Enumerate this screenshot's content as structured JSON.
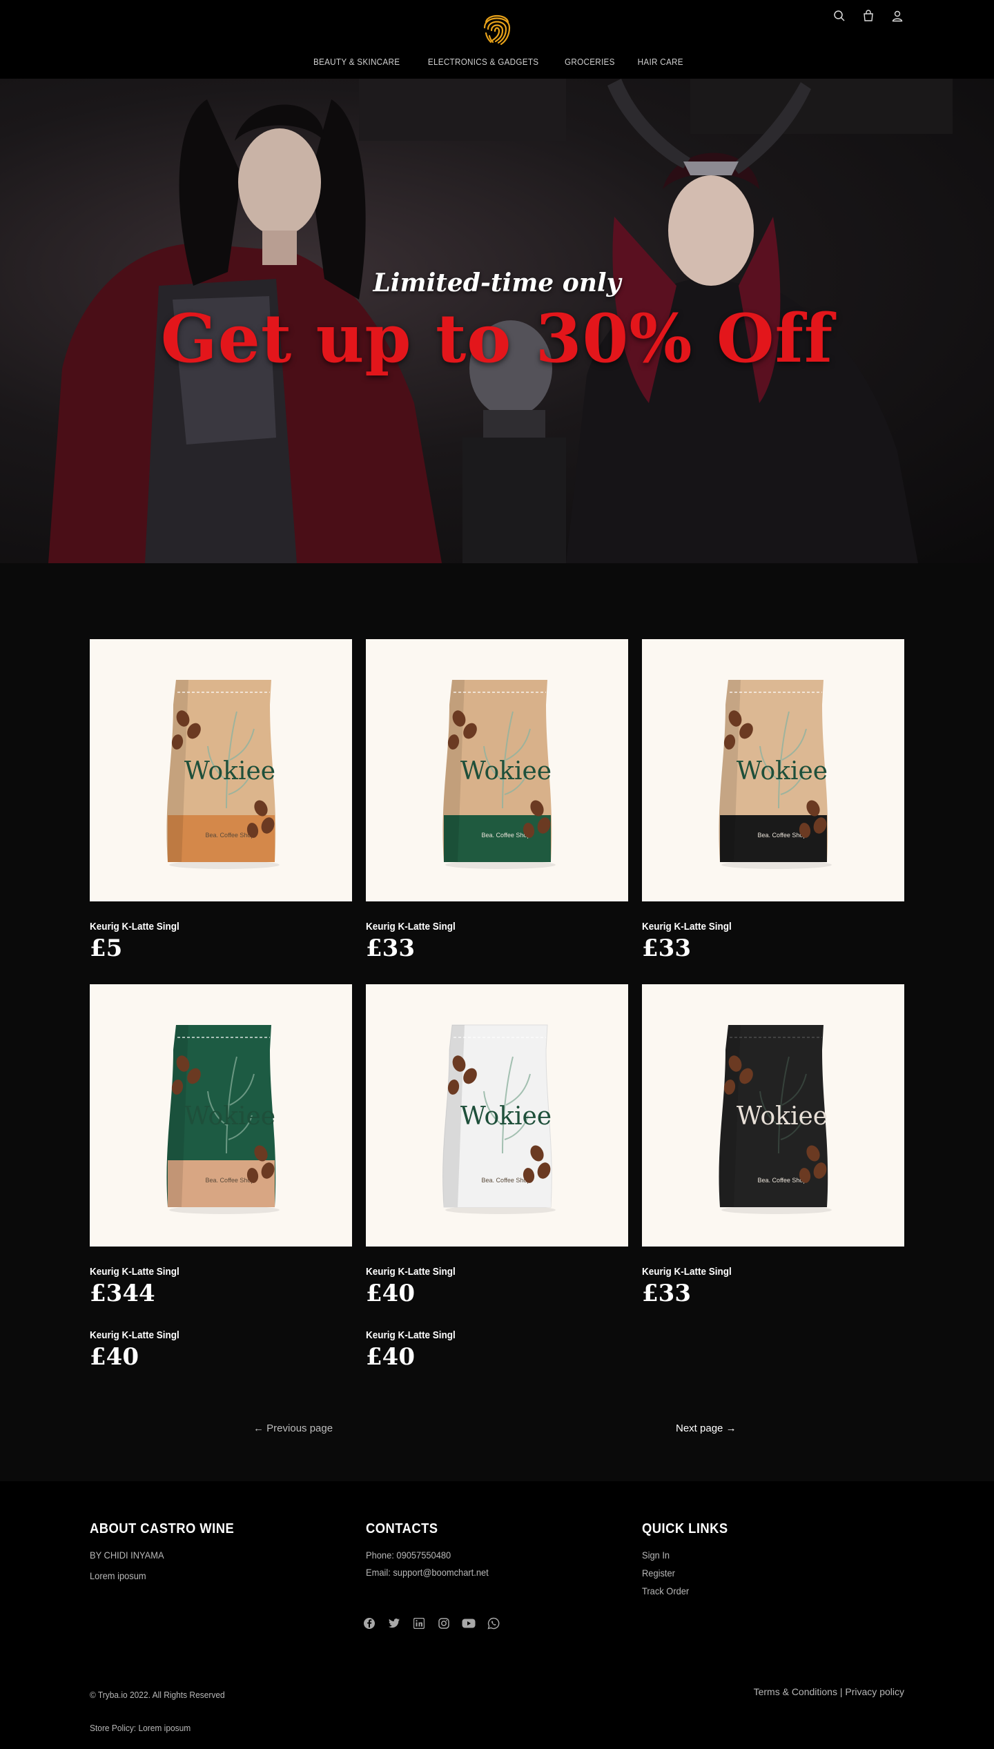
{
  "header": {
    "nav": [
      "BEAUTY & SKINCARE",
      "ELECTRONICS & GADGETS",
      "GROCERIES",
      "HAIR CARE"
    ],
    "icons": [
      "search-icon",
      "bag-icon",
      "user-icon"
    ],
    "logo_color": "#e8a21a"
  },
  "hero": {
    "subtitle": "Limited-time only",
    "title": "Get up to 30% Off",
    "title_color": "#e3161b"
  },
  "products": [
    {
      "name": "Keurig K-Latte Singl",
      "price": "£5",
      "bag_body": "#dcb58c",
      "bag_band": "#d4884a",
      "brand": "Wokiee",
      "tag": "Coffee Shop"
    },
    {
      "name": "Keurig K-Latte Singl",
      "price": "£33",
      "bag_body": "#d8b18a",
      "bag_band": "#1f5a3f",
      "brand": "Wokiee",
      "tag": "Coffee Shop"
    },
    {
      "name": "Keurig K-Latte Singl",
      "price": "£33",
      "bag_body": "#dcb893",
      "bag_band": "#1a1a1a",
      "brand": "Wokiee",
      "tag": "Coffee Shop"
    },
    {
      "name": "Keurig K-Latte Singl",
      "price": "£344",
      "bag_body": "#1d5b43",
      "bag_band": "#d8a683",
      "brand": "Wokiee",
      "tag": "Coffee Shop"
    },
    {
      "name": "Keurig K-Latte Singl",
      "price": "£40",
      "bag_body": "#f2f2f2",
      "bag_band": "#f2f2f2",
      "brand": "Wokiee",
      "tag": "Coffee Shop"
    },
    {
      "name": "Keurig K-Latte Singl",
      "price": "£33",
      "bag_body": "#222222",
      "bag_band": "#222222",
      "brand": "Wokiee",
      "tag": "Coffee Shop"
    }
  ],
  "products_noimg": [
    {
      "name": "Keurig K-Latte Singl",
      "price": "£40"
    },
    {
      "name": "Keurig K-Latte Singl",
      "price": "£40"
    }
  ],
  "pagination": {
    "prev": "Previous page",
    "next": "Next page"
  },
  "footer": {
    "about_title": "ABOUT CASTRO WINE",
    "about_by": "BY CHIDI INYAMA",
    "about_text": "Lorem iposum",
    "contacts_title": "CONTACTS",
    "phone": "Phone: 09057550480",
    "email": "Email: support@boomchart.net",
    "links_title": "QUICK LINKS",
    "links": [
      "Sign In",
      "Register",
      "Track Order"
    ],
    "social": [
      "facebook-icon",
      "twitter-icon",
      "linkedin-icon",
      "instagram-icon",
      "youtube-icon",
      "whatsapp-icon"
    ],
    "copyright": "© Tryba.io 2022. All Rights Reserved",
    "store_policy": "Store Policy: Lorem iposum",
    "terms": "Terms & Conditions",
    "separator": "|",
    "privacy": "Privacy policy"
  }
}
